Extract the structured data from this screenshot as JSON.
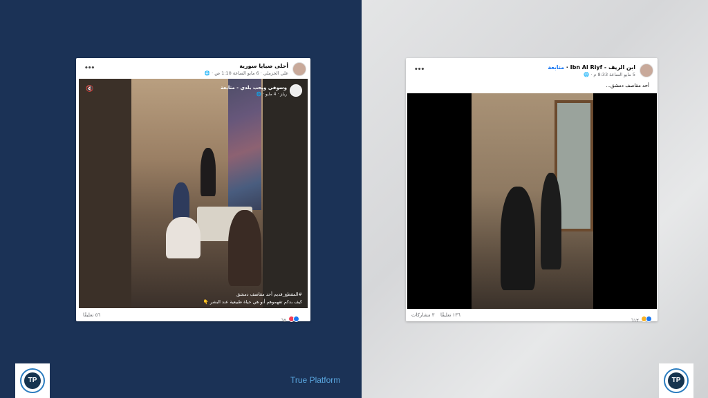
{
  "brand": {
    "text": "True Platform",
    "logo_text": "TP"
  },
  "colors": {
    "left_bg": "#1b3256",
    "accent": "#5aa7e0",
    "fb_blue": "#1877f2"
  },
  "post_left": {
    "page_name": "أحلى صبايا سورية",
    "meta": "علي الخزملي · 6 مايو الساعة 1:10 ص · 🌐",
    "embedded": {
      "name": "وسوفي ويحب بلدي - متابعة",
      "meta": "ريلز · 4 مايو · 🌐"
    },
    "caption_lines": [
      "#المقطع_قديم    أحد مقاصف دمشق",
      "كيف بدكم تفهموهم أنو هي حياة طبيعية عند البشر 👇"
    ],
    "reactions_count": "٦٥",
    "comments": "٥٦ تعليقًا"
  },
  "post_right": {
    "page_name": "ابن الريف - Ibn Al Riyf",
    "follow": "متابعة",
    "meta": "5 مايو الساعة 8:33 م · 🌐",
    "text": "أحد مقاصف دمشق...",
    "reactions_count": "٦١٢",
    "comments": "١٣٦ تعليقًا",
    "shares": "٣ مشاركات"
  }
}
